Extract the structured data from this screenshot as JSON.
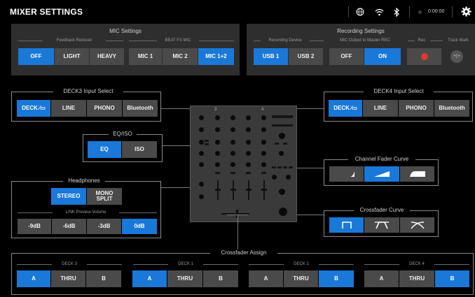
{
  "app": {
    "title": "MIXER SETTINGS"
  },
  "status_bar": {
    "time": "0:00:00",
    "icons": [
      "globe-icon",
      "wifi-icon",
      "bluetooth-icon",
      "gear-icon"
    ]
  },
  "mic_settings": {
    "title": "MIC Settings",
    "feedback_reducer": {
      "label": "Feedback Reducer",
      "options": [
        "OFF",
        "LIGHT",
        "HEAVY"
      ],
      "selected": "OFF"
    },
    "beat_fx_mic": {
      "label": "BEAT FX MIC",
      "options": [
        "MIC 1",
        "MIC 2",
        "MIC 1+2"
      ],
      "selected": "MIC 1+2"
    }
  },
  "recording_settings": {
    "title": "Recording Settings",
    "recording_device": {
      "label": "Recording Device",
      "options": [
        "USB 1",
        "USB 2"
      ],
      "selected": "USB 1"
    },
    "mic_output": {
      "label": "MIC Output to Master REC",
      "options": [
        "OFF",
        "ON"
      ],
      "selected": "ON"
    },
    "rec": {
      "label": "Rec"
    },
    "track_mark": {
      "label": "Track Mark"
    }
  },
  "deck3_input": {
    "title": "DECK3 Input Select",
    "options": [
      "DECK",
      "LINE",
      "PHONO",
      "Bluetooth"
    ],
    "selected": "DECK"
  },
  "deck4_input": {
    "title": "DECK4 Input Select",
    "options": [
      "DECK",
      "LINE",
      "PHONO",
      "Bluetooth"
    ],
    "selected": "DECK"
  },
  "eq_iso": {
    "title": "EQ/ISO",
    "options": [
      "EQ",
      "ISO"
    ],
    "selected": "EQ"
  },
  "headphones": {
    "title": "Headphones",
    "options": [
      "STEREO",
      "MONO SPLIT"
    ],
    "selected": "STEREO",
    "link_preview": {
      "label": "LINK Preview Volume",
      "options": [
        "-9dB",
        "-6dB",
        "-3dB",
        "0dB"
      ],
      "selected": "0dB"
    }
  },
  "channel_fader_curve": {
    "title": "Channel Fader Curve",
    "options": [
      "curve-slow-icon",
      "curve-linear-icon",
      "curve-fast-icon"
    ],
    "selected_index": 1
  },
  "crossfader_curve": {
    "title": "Crossfader Curve",
    "options": [
      "curve-sharp-cut-icon",
      "curve-medium-icon",
      "curve-smooth-icon"
    ],
    "selected_index": 0
  },
  "mixer": {
    "ch3": "3",
    "ch4": "4"
  },
  "crossfader_assign": {
    "title": "Crossfader Assign",
    "decks": [
      {
        "name": "DECK 3",
        "options": [
          "A",
          "THRU",
          "B"
        ],
        "selected": "A"
      },
      {
        "name": "DECK 1",
        "options": [
          "A",
          "THRU",
          "B"
        ],
        "selected": "A"
      },
      {
        "name": "DECK 2",
        "options": [
          "A",
          "THRU",
          "B"
        ],
        "selected": "B"
      },
      {
        "name": "DECK 4",
        "options": [
          "A",
          "THRU",
          "B"
        ],
        "selected": "B"
      }
    ]
  },
  "colors": {
    "accent": "#1a78d8",
    "button": "#4a4a4a",
    "panel": "#2e2e2e",
    "background": "#000000",
    "rec_red": "#e03a2a"
  }
}
